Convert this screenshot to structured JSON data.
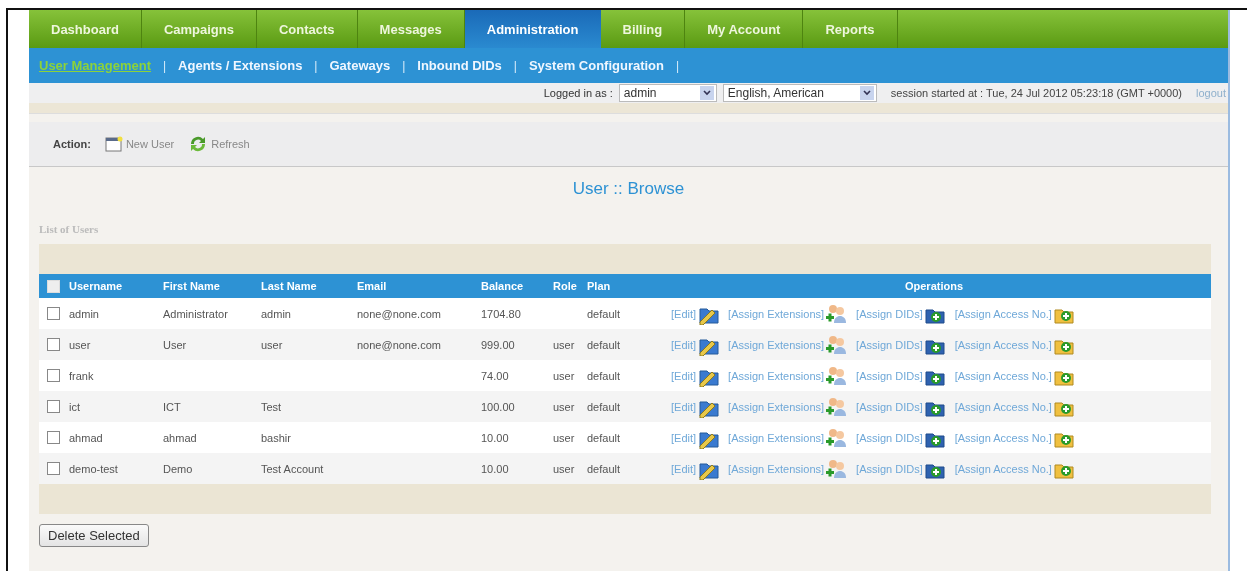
{
  "tabs": [
    {
      "label": "Dashboard",
      "selected": false
    },
    {
      "label": "Campaigns",
      "selected": false
    },
    {
      "label": "Contacts",
      "selected": false
    },
    {
      "label": "Messages",
      "selected": false
    },
    {
      "label": "Administration",
      "selected": true
    },
    {
      "label": "Billing",
      "selected": false
    },
    {
      "label": "My Account",
      "selected": false
    },
    {
      "label": "Reports",
      "selected": false
    }
  ],
  "subtabs": [
    {
      "label": "User Management",
      "selected": true
    },
    {
      "label": "Agents / Extensions",
      "selected": false
    },
    {
      "label": "Gateways",
      "selected": false
    },
    {
      "label": "Inbound DIDs",
      "selected": false
    },
    {
      "label": "System Configuration",
      "selected": false
    }
  ],
  "separator": "|",
  "login_bar": {
    "logged_in_label": "Logged in as :",
    "user_select": "admin",
    "language_select": "English, American",
    "session": "session started at : Tue, 24 Jul 2012 05:23:18 (GMT +0000)",
    "logout": "logout"
  },
  "actions": {
    "label": "Action:",
    "buttons": [
      {
        "label": "New User",
        "kind": "new"
      },
      {
        "label": "Refresh",
        "kind": "refresh"
      }
    ]
  },
  "page_title": "User :: Browse",
  "list_title": "List of Users",
  "table": {
    "select_all_checked": false,
    "columns": [
      "Username",
      "First Name",
      "Last Name",
      "Email",
      "Balance",
      "Role",
      "Plan",
      "Operations"
    ],
    "rows": [
      {
        "checked": false,
        "cells": [
          "admin",
          "Administrator",
          "admin",
          "none@none.com",
          "1704.80",
          "",
          "default"
        ],
        "operations": [
          {
            "label": "[Edit]",
            "kind": "edit"
          },
          {
            "label": "[Assign Extensions]",
            "kind": "extensions"
          },
          {
            "label": "[Assign DIDs]",
            "kind": "dids"
          },
          {
            "label": "[Assign Access No.]",
            "kind": "access"
          }
        ]
      },
      {
        "checked": false,
        "cells": [
          "user",
          "User",
          "user",
          "none@none.com",
          "999.00",
          "user",
          "default"
        ],
        "operations": [
          {
            "label": "[Edit]",
            "kind": "edit"
          },
          {
            "label": "[Assign Extensions]",
            "kind": "extensions"
          },
          {
            "label": "[Assign DIDs]",
            "kind": "dids"
          },
          {
            "label": "[Assign Access No.]",
            "kind": "access"
          }
        ]
      },
      {
        "checked": false,
        "cells": [
          "frank",
          "",
          "",
          "",
          "74.00",
          "user",
          "default"
        ],
        "operations": [
          {
            "label": "[Edit]",
            "kind": "edit"
          },
          {
            "label": "[Assign Extensions]",
            "kind": "extensions"
          },
          {
            "label": "[Assign DIDs]",
            "kind": "dids"
          },
          {
            "label": "[Assign Access No.]",
            "kind": "access"
          }
        ]
      },
      {
        "checked": false,
        "cells": [
          "ict",
          "ICT",
          "Test",
          "",
          "100.00",
          "user",
          "default"
        ],
        "operations": [
          {
            "label": "[Edit]",
            "kind": "edit"
          },
          {
            "label": "[Assign Extensions]",
            "kind": "extensions"
          },
          {
            "label": "[Assign DIDs]",
            "kind": "dids"
          },
          {
            "label": "[Assign Access No.]",
            "kind": "access"
          }
        ]
      },
      {
        "checked": false,
        "cells": [
          "ahmad",
          "ahmad",
          "bashir",
          "",
          "10.00",
          "user",
          "default"
        ],
        "operations": [
          {
            "label": "[Edit]",
            "kind": "edit"
          },
          {
            "label": "[Assign Extensions]",
            "kind": "extensions"
          },
          {
            "label": "[Assign DIDs]",
            "kind": "dids"
          },
          {
            "label": "[Assign Access No.]",
            "kind": "access"
          }
        ]
      },
      {
        "checked": false,
        "cells": [
          "demo-test",
          "Demo",
          "Test Account",
          "",
          "10.00",
          "user",
          "default"
        ],
        "operations": [
          {
            "label": "[Edit]",
            "kind": "edit"
          },
          {
            "label": "[Assign Extensions]",
            "kind": "extensions"
          },
          {
            "label": "[Assign DIDs]",
            "kind": "dids"
          },
          {
            "label": "[Assign Access No.]",
            "kind": "access"
          }
        ]
      }
    ]
  },
  "delete_button": "Delete Selected"
}
